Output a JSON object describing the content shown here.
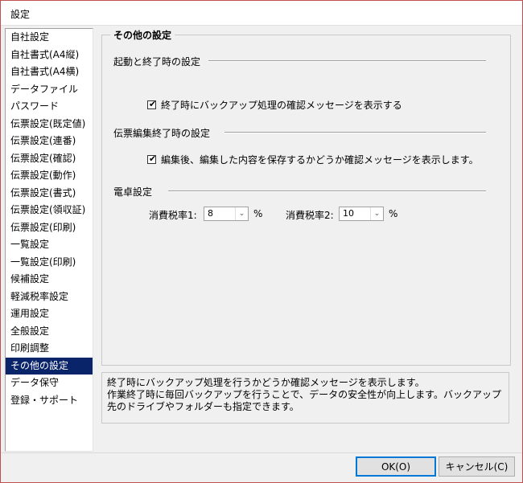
{
  "window": {
    "title": "設定"
  },
  "sidebar": {
    "items": [
      {
        "label": "自社設定"
      },
      {
        "label": "自社書式(A4縦)"
      },
      {
        "label": "自社書式(A4横)"
      },
      {
        "label": "データファイル"
      },
      {
        "label": "パスワード"
      },
      {
        "label": "伝票設定(既定値)"
      },
      {
        "label": "伝票設定(連番)"
      },
      {
        "label": "伝票設定(確認)"
      },
      {
        "label": "伝票設定(動作)"
      },
      {
        "label": "伝票設定(書式)"
      },
      {
        "label": "伝票設定(領収証)"
      },
      {
        "label": "伝票設定(印刷)"
      },
      {
        "label": "一覧設定"
      },
      {
        "label": "一覧設定(印刷)"
      },
      {
        "label": "候補設定"
      },
      {
        "label": "軽減税率設定"
      },
      {
        "label": "運用設定"
      },
      {
        "label": "全般設定"
      },
      {
        "label": "印刷調整"
      },
      {
        "label": "その他の設定",
        "selected": true
      },
      {
        "label": "データ保守"
      },
      {
        "label": "登録・サポート"
      }
    ]
  },
  "main": {
    "group_title": "その他の設定",
    "section_startup": {
      "label": "起動と終了時の設定",
      "checkbox_label": "終了時にバックアップ処理の確認メッセージを表示する",
      "checked": true
    },
    "section_edit": {
      "label": "伝票編集終了時の設定",
      "checkbox_label": "編集後、編集した内容を保存するかどうか確認メッセージを表示します。",
      "checked": true
    },
    "section_calc": {
      "label": "電卓設定",
      "tax1_label": "消費税率1:",
      "tax1_value": "8",
      "tax2_label": "消費税率2:",
      "tax2_value": "10",
      "unit": "%"
    }
  },
  "description": {
    "line1": "終了時にバックアップ処理を行うかどうか確認メッセージを表示します。",
    "line2": "作業終了時に毎回バックアップを行うことで、データの安全性が向上します。バックアップ先のドライブやフォルダーも指定できます。"
  },
  "buttons": {
    "ok": "OK(O)",
    "cancel": "キャンセル(C)"
  },
  "icons": {
    "check": "check-icon",
    "dropdown": "chevron-down-icon"
  }
}
